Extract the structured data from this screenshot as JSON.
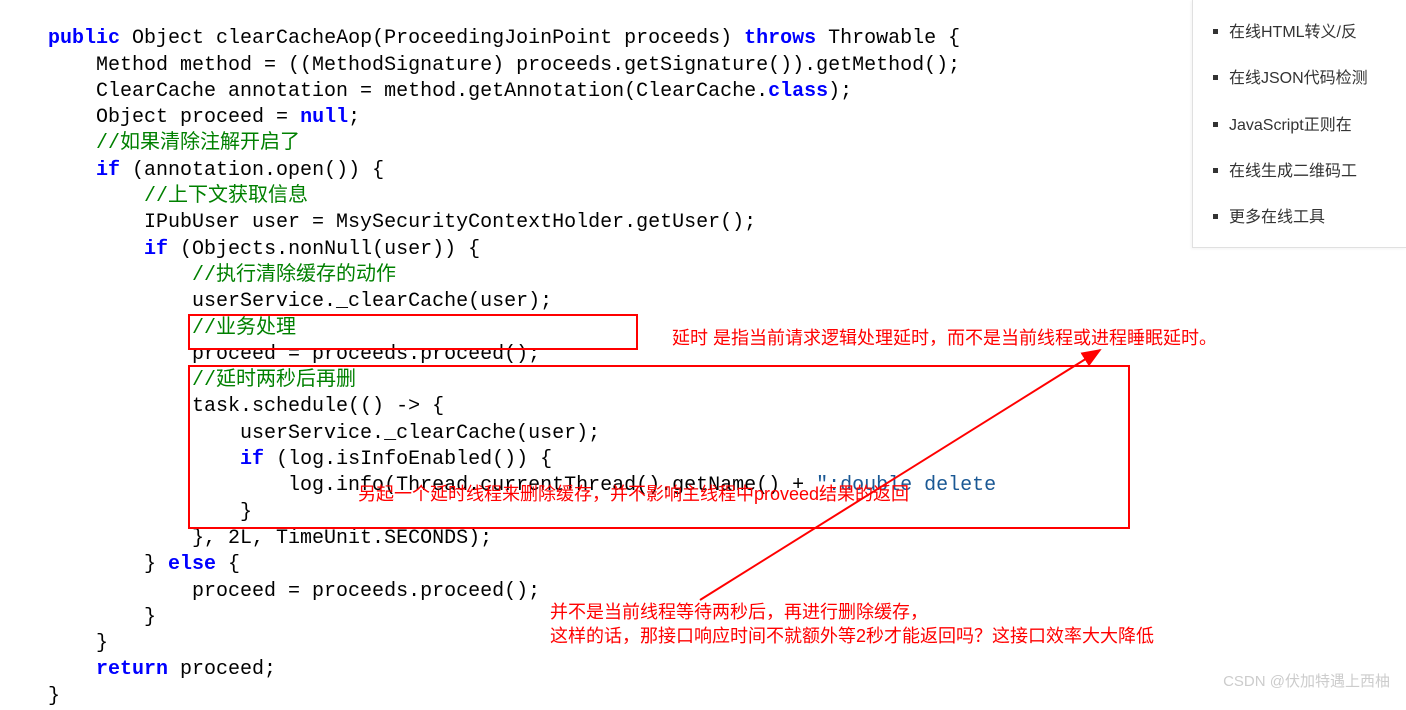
{
  "code": {
    "l1a": "public",
    "l1b": " Object clearCacheAop(ProceedingJoinPoint proceeds) ",
    "l1c": "throws",
    "l1d": " Throwable {",
    "l2": "        Method method = ((MethodSignature) proceeds.getSignature()).getMethod();",
    "l3a": "        ClearCache annotation = method.getAnnotation(ClearCache.",
    "l3b": "class",
    "l3c": ");",
    "l4a": "        Object proceed = ",
    "l4b": "null",
    "l4c": ";",
    "l5": "        //如果清除注解开启了",
    "l6a": "        ",
    "l6b": "if",
    "l6c": " (annotation.open()) {",
    "l7": "            //上下文获取信息",
    "l8": "            IPubUser user = MsySecurityContextHolder.getUser();",
    "l9a": "            ",
    "l9b": "if",
    "l9c": " (Objects.nonNull(user)) {",
    "l10": "                //执行清除缓存的动作",
    "l11": "                userService._clearCache(user);",
    "l12": "                //业务处理",
    "l13": "                proceed = proceeds.proceed();",
    "l14": "                //延时两秒后再删",
    "l15": "                task.schedule(() -> {",
    "l16": "                    userService._clearCache(user);",
    "l17a": "                    ",
    "l17b": "if",
    "l17c": " (log.isInfoEnabled()) {",
    "l18a": "                        log.info(Thread.currentThread().getName() + ",
    "l18b": "\":double delete",
    "l19": "                    }",
    "l20": "                }, 2L, TimeUnit.SECONDS);",
    "l21a": "            } ",
    "l21b": "else",
    "l21c": " {",
    "l22": "                proceed = proceeds.proceed();",
    "l23": "            }",
    "l24": "        }",
    "l25a": "        ",
    "l25b": "return",
    "l25c": " proceed;",
    "l26": "    }"
  },
  "annotations": {
    "a1": "延时 是指当前请求逻辑处理延时，而不是当前线程或进程睡眠延时。",
    "a2": "另起一个延时线程来删除缓存，并不影响主线程中proveed结果的返回",
    "a3_line1": "并不是当前线程等待两秒后，再进行删除缓存，",
    "a3_line2": "这样的话，那接口响应时间不就额外等2秒才能返回吗？这接口效率大大降低"
  },
  "sidebar": {
    "items": [
      "在线HTML转义/反",
      "在线JSON代码检测",
      "JavaScript正则在",
      "在线生成二维码工",
      "更多在线工具"
    ]
  },
  "watermark": "CSDN @伏加特遇上西柚"
}
